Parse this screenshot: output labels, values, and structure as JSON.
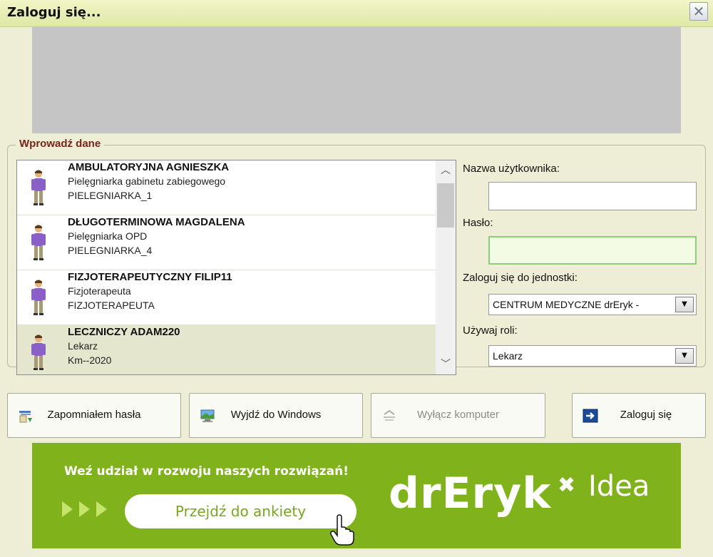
{
  "window": {
    "title": "Zaloguj się...",
    "close_glyph": "✕"
  },
  "group": {
    "legend": "Wprowadź dane"
  },
  "users": [
    {
      "name": "AMBULATORYJNA AGNIESZKA",
      "role": "Pielęgniarka gabinetu zabiegowego",
      "code": "PIELEGNIARKA_1"
    },
    {
      "name": "DŁUGOTERMINOWA MAGDALENA",
      "role": "Pielęgniarka OPD",
      "code": "PIELEGNIARKA_4"
    },
    {
      "name": "FIZJOTERAPEUTYCZNY FILIP11",
      "role": "Fizjoterapeuta",
      "code": "FIZJOTERAPEUTA"
    },
    {
      "name": "LECZNICZY ADAM220",
      "role": "Lekarz",
      "code": "Km--2020"
    }
  ],
  "scrollbar": {
    "up_glyph": "︿",
    "down_glyph": "﹀"
  },
  "form": {
    "username_label": "Nazwa użytkownika:",
    "username_value": "",
    "password_label": "Hasło:",
    "password_value": "",
    "unit_label": "Zaloguj się do jednostki:",
    "unit_value": "CENTRUM MEDYCZNE drEryk - ",
    "role_label": "Używaj roli:",
    "role_value": "Lekarz",
    "dropdown_glyph": "▼"
  },
  "buttons": {
    "forgot": "Zapomniałem hasła",
    "exit": "Wyjdź do Windows",
    "shutdown": "Wyłącz komputer",
    "login": "Zaloguj się"
  },
  "ad": {
    "headline": "Weź udział w rozwoju naszych rozwiązań!",
    "cta": "Przejdź do ankiety",
    "brand": "drEryk",
    "brand_x": "✖",
    "brand_suffix": "Idea"
  },
  "colors": {
    "title_bar": "#e6edb0",
    "ad_green": "#80b31b",
    "legend_red": "#7a2318",
    "selected_row": "#e4e6cd"
  },
  "icons": [
    "close-icon",
    "person-icon",
    "chevron-up-icon",
    "chevron-down-icon",
    "forgot-password-icon",
    "windows-exit-icon",
    "shutdown-icon",
    "login-arrow-icon",
    "hand-cursor-icon"
  ]
}
